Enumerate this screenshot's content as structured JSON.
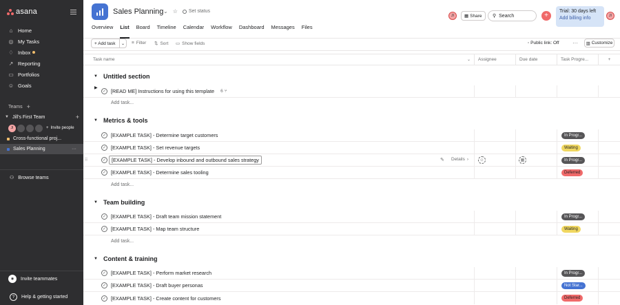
{
  "sidebar": {
    "logo": "asana",
    "nav": [
      {
        "label": "Home",
        "icon": "home-icon"
      },
      {
        "label": "My Tasks",
        "icon": "check-circle-icon"
      },
      {
        "label": "Inbox",
        "icon": "bell-icon"
      },
      {
        "label": "Reporting",
        "icon": "line-chart-icon"
      },
      {
        "label": "Portfolios",
        "icon": "folder-icon"
      },
      {
        "label": "Goals",
        "icon": "person-icon"
      }
    ],
    "teams_label": "Teams",
    "team_name": "Jill's First Team",
    "avatar_initials": "JI",
    "invite_people": "Invite people",
    "projects": [
      {
        "label": "Cross-functional proj...",
        "color": "#f1bd6c"
      },
      {
        "label": "Sales Planning",
        "color": "#4573d2"
      }
    ],
    "browse_teams": "Browse teams",
    "invite_teammates": "Invite teammates",
    "help": "Help & getting started"
  },
  "header": {
    "project_title": "Sales Planning",
    "set_status": "Set status",
    "tabs": [
      "Overview",
      "List",
      "Board",
      "Timeline",
      "Calendar",
      "Workflow",
      "Dashboard",
      "Messages",
      "Files"
    ],
    "active_tab": "List",
    "avatar_initials": "JI",
    "share": "Share",
    "search_placeholder": "Search",
    "trial_line1": "Trial: 30 days left",
    "trial_line2": "Add billing info"
  },
  "toolbar": {
    "add_task": "Add task",
    "filter": "Filter",
    "sort": "Sort",
    "show_fields": "Show fields",
    "public_link": "Public link: Off",
    "customize": "Customize"
  },
  "columns": {
    "task_name": "Task name",
    "assignee": "Assignee",
    "due_date": "Due date",
    "task_progress": "Task Progre..."
  },
  "add_task_link": "Add task...",
  "details": "Details",
  "sections": [
    {
      "title": "Untitled section",
      "tasks": [
        {
          "name": "[READ ME] Instructions for using this template",
          "subtasks": "6",
          "status": ""
        }
      ]
    },
    {
      "title": "Metrics & tools",
      "tasks": [
        {
          "name": "[EXAMPLE TASK] - Determine target customers",
          "status": "In Progr..."
        },
        {
          "name": "[EXAMPLE TASK] - Set revenue targets",
          "status": "Waiting"
        },
        {
          "name": "[EXAMPLE TASK] - Develop inbound and outbound sales strategy",
          "status": "In Progr..."
        },
        {
          "name": "[EXAMPLE TASK] - Determine sales tooling",
          "status": "Deferred"
        }
      ]
    },
    {
      "title": "Team building",
      "tasks": [
        {
          "name": "[EXAMPLE TASK] - Draft team mission statement",
          "status": "In Progr..."
        },
        {
          "name": "[EXAMPLE TASK] - Map team structure",
          "status": "Waiting"
        }
      ]
    },
    {
      "title": "Content & training",
      "tasks": [
        {
          "name": "[EXAMPLE TASK] - Perform market research",
          "status": "In Progr..."
        },
        {
          "name": "[EXAMPLE TASK] - Draft buyer personas",
          "status": "Not Star..."
        },
        {
          "name": "[EXAMPLE TASK] - Create content for customers",
          "status": "Deferred"
        }
      ]
    }
  ]
}
